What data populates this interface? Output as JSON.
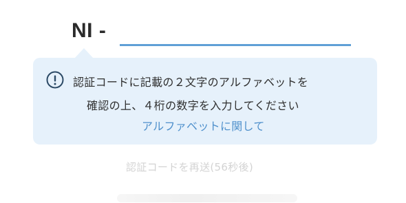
{
  "code_entry": {
    "prefix": "NI -",
    "value": ""
  },
  "tooltip": {
    "line1": "認証コードに記載の２文字のアルファベットを",
    "line2": "確認の上、４桁の数字を入力してください",
    "link": "アルファベットに関して",
    "icon": "info-icon"
  },
  "resend": {
    "label": "認証コードを再送(56秒後)"
  },
  "colors": {
    "accent": "#5f9fd6",
    "link": "#4f90cc",
    "tooltip_bg": "#e6f1fb",
    "disabled_text": "#d3d3d3"
  }
}
